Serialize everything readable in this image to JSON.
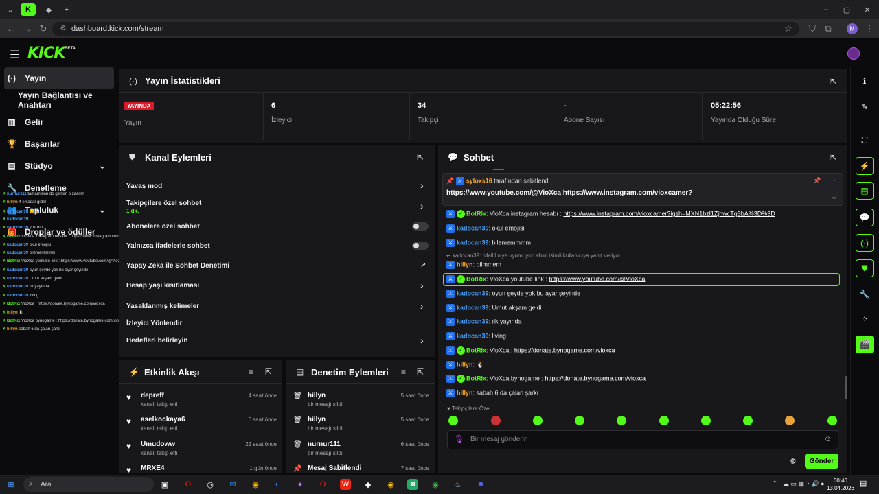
{
  "browser": {
    "url": "dashboard.kick.com/stream",
    "profile_initial": "M"
  },
  "header": {
    "logo": "KICK",
    "beta": "BETA"
  },
  "sidebar": {
    "items": [
      {
        "label": "Yayın",
        "icon": "broadcast-icon"
      },
      {
        "label": "Yayın Bağlantısı ve Anahtarı",
        "icon": ""
      },
      {
        "label": "Gelir",
        "icon": "chart-icon"
      },
      {
        "label": "Başarılar",
        "icon": "trophy-icon"
      },
      {
        "label": "Stüdyo",
        "icon": "studio-icon"
      },
      {
        "label": "Denetleme",
        "icon": "wrench-icon"
      },
      {
        "label": "Topluluk",
        "icon": "people-icon"
      },
      {
        "label": "Droplar ve ödüller",
        "icon": "gift-icon"
      }
    ]
  },
  "stats": {
    "title": "Yayın İstatistikleri",
    "live_badge": "YAYINDA",
    "cells": [
      {
        "value": "",
        "label": "Yayın"
      },
      {
        "value": "6",
        "label": "İzleyici"
      },
      {
        "value": "34",
        "label": "Takipçi"
      },
      {
        "value": "-",
        "label": "Abone Sayısı"
      },
      {
        "value": "05:22:56",
        "label": "Yayında Olduğu Süre"
      }
    ]
  },
  "actions": {
    "title": "Kanal Eylemleri",
    "rows": [
      {
        "label": "Yavaş mod",
        "control": "chevron"
      },
      {
        "label": "Takipçilere özel sohbet",
        "sub": "1 dk.",
        "control": "chevron"
      },
      {
        "label": "Abonelere özel sohbet",
        "control": "toggle"
      },
      {
        "label": "Yalnızca ifadelerle sohbet",
        "control": "toggle"
      },
      {
        "label": "Yapay Zeka ile Sohbet Denetimi",
        "control": "external"
      },
      {
        "label": "Hesap yaşı kısıtlaması",
        "control": "chevron"
      },
      {
        "label": "Yasaklanmış kelimeler",
        "control": "chevron"
      },
      {
        "label": "İzleyici Yönlendir",
        "control": "none"
      },
      {
        "label": "Hedefleri belirleyin",
        "control": "chevron"
      }
    ]
  },
  "activity": {
    "title": "Etkinlik Akışı",
    "items": [
      {
        "name": "depreff",
        "sub": "kanalı takip etti",
        "time": "4 saat önce"
      },
      {
        "name": "aselkockaya6",
        "sub": "kanalı takip etti",
        "time": "6 saat önce"
      },
      {
        "name": "Umudoww",
        "sub": "kanalı takip etti",
        "time": "22 saat önce"
      },
      {
        "name": "MRXE4",
        "sub": "",
        "time": "1 gün önce"
      }
    ]
  },
  "moderation": {
    "title": "Denetim Eylemleri",
    "items": [
      {
        "name": "hillyn",
        "sub": "bir mesajı sildi",
        "time": "5 saat önce"
      },
      {
        "name": "hillyn",
        "sub": "bir mesajı sildi",
        "time": "5 saat önce"
      },
      {
        "name": "nurnur111",
        "sub": "bir mesajı sildi",
        "time": "6 saat önce"
      },
      {
        "name": "Mesaj Sabitlendi",
        "sub": "",
        "time": "7 saat önce"
      }
    ]
  },
  "chat": {
    "title": "Sohbet",
    "pinned_by_user": "syloxs16",
    "pinned_by_text": "tarafından sabitlendi",
    "pinned_link1": "https://www.youtube.com/@VioXca",
    "pinned_link2": "https://www.instagram.com/vioxcamer?",
    "messages": [
      {
        "user": "BotRix",
        "color": "green",
        "bot": true,
        "text": "VioXca instagram hesabı : ",
        "link": "https://www.instagram.com/vioxcamer?igsh=MXN1bzl1ZjhwcTg3bA%3D%3D"
      },
      {
        "user": "kadocan39",
        "color": "blue",
        "text": "okul emojisi"
      },
      {
        "user": "kadocan39",
        "color": "blue",
        "text": "bilememmmm"
      },
      {
        "reply": "kadocan39: hilallll niye uyumuyon abim isimli kullanıcıya yanıt veriyor"
      },
      {
        "user": "hillyn",
        "color": "orange",
        "text": "bilmmem"
      },
      {
        "user": "BotRix",
        "color": "green",
        "bot": true,
        "text": "VioXca youtube link : ",
        "link": "https://www.youtube.com/@VioXca",
        "highlight": true
      },
      {
        "user": "kadocan39",
        "color": "blue",
        "text": "oyun şeyde yok bu ayar şeyinde"
      },
      {
        "user": "kadocan39",
        "color": "blue",
        "text": "Umut akşam geldi"
      },
      {
        "user": "kadocan39",
        "color": "blue",
        "text": "ılk yayında"
      },
      {
        "user": "kadocan39",
        "color": "blue",
        "text": "living"
      },
      {
        "user": "BotRix",
        "color": "green",
        "bot": true,
        "text": "VioXca : ",
        "link": "https://donate.bynogame.com/vioxca"
      },
      {
        "user": "hillyn",
        "color": "orange",
        "text": "🐧"
      },
      {
        "user": "BotRix",
        "color": "green",
        "bot": true,
        "text": "VioXca bynogame : ",
        "link": "https://donate.bynogame.com/vioxca"
      },
      {
        "user": "hillyn",
        "color": "orange",
        "text": "sabah 6 da çalan şarkı"
      }
    ],
    "followers_only": "Takipçilere Özel",
    "input_placeholder": "Bir mesaj gönderin",
    "send_label": "Gönder"
  },
  "overlay_chat": [
    {
      "u": "nurnur111",
      "t": "tamam ben do gellom o zaamn",
      "c": ""
    },
    {
      "u": "hillyn",
      "t": "4 e kadar gider",
      "c": "o"
    },
    {
      "u": "kadocan39",
      "t": "😊👔",
      "c": ""
    },
    {
      "u": "kadocan39",
      "t": "",
      "c": ""
    },
    {
      "u": "kadocan39",
      "t": "yok mu",
      "c": ""
    },
    {
      "u": "BotRix",
      "t": "VioXca instagram hesabı : https://www.instagram.com/vioxcamer?igsh=MXN1bzl1ZjhwcTg3bA%3D%3D",
      "c": "g"
    },
    {
      "u": "kadocan39",
      "t": "okul emojisi",
      "c": ""
    },
    {
      "u": "kadocan39",
      "t": "bilememmmm",
      "c": ""
    },
    {
      "u": "BotRix",
      "t": "VioXca youtube link : https://www.youtube.com/@VioXca",
      "c": "g"
    },
    {
      "u": "kadocan39",
      "t": "oyun şeyde yok bu ayar şeyinde",
      "c": ""
    },
    {
      "u": "kadocan39",
      "t": "Umut akşam geldi",
      "c": ""
    },
    {
      "u": "kadocan39",
      "t": "ılk yayında",
      "c": ""
    },
    {
      "u": "kadocan39",
      "t": "living",
      "c": ""
    },
    {
      "u": "BotRix",
      "t": "VioXca : https://donate.bynogame.com/vioxca",
      "c": "g"
    },
    {
      "u": "hillyn",
      "t": "🐧",
      "c": "o"
    },
    {
      "u": "BotRix",
      "t": "VioXca bynogame : https://donate.bynogame.com/vioxca",
      "c": "g"
    },
    {
      "u": "hillyn",
      "t": "sabah 6 da çalan şarkı",
      "c": "o"
    }
  ],
  "taskbar": {
    "search_placeholder": "Ara",
    "time": "00:40",
    "date": "13.04.2026"
  }
}
